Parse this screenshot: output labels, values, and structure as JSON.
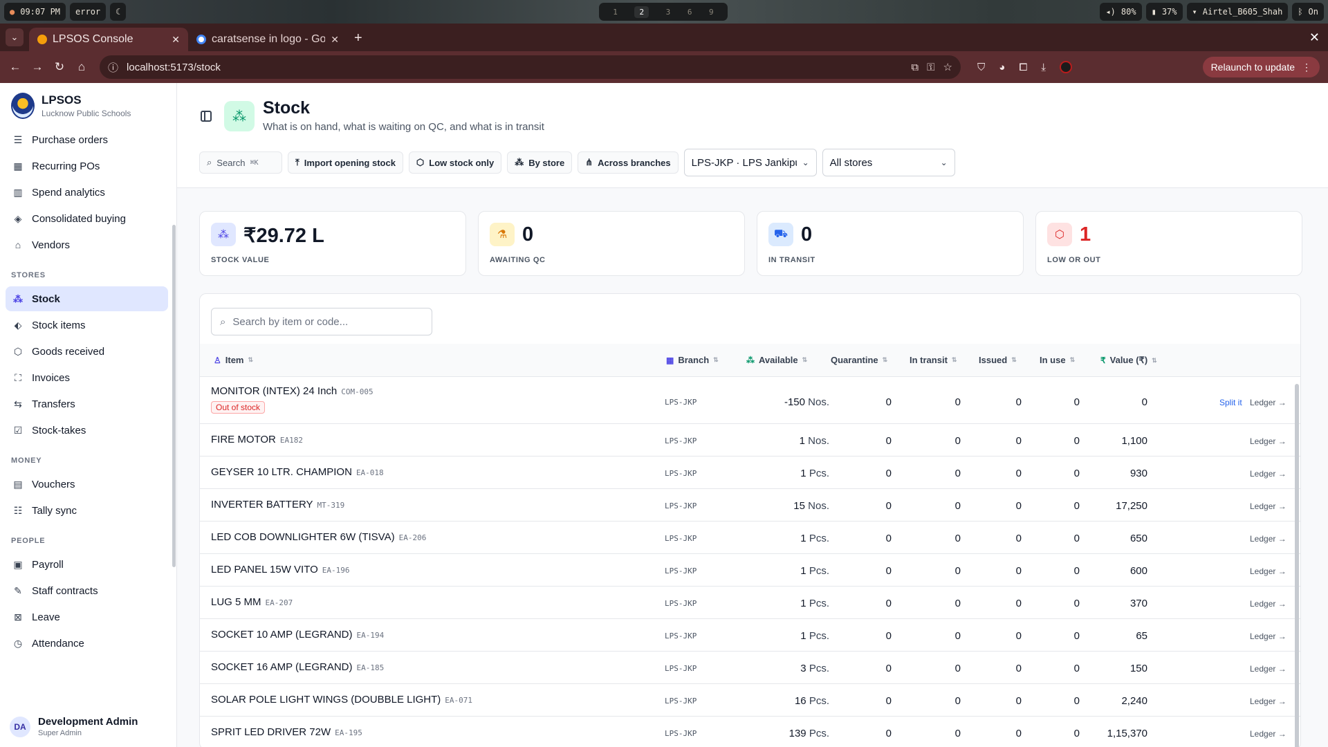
{
  "system": {
    "time": "09:07 PM",
    "status": "error",
    "workspaces": [
      "1",
      "2",
      "3",
      "6",
      "9"
    ],
    "active_workspace": "2",
    "volume": "80%",
    "battery": "37%",
    "wifi": "Airtel_B605_Shah",
    "bt": "On"
  },
  "browser": {
    "tabs": [
      {
        "title": "LPSOS Console"
      },
      {
        "title": "caratsense in logo - Go"
      }
    ],
    "url": "localhost:5173/stock",
    "relaunch_label": "Relaunch to update"
  },
  "app": {
    "name": "LPSOS",
    "subtitle": "Lucknow Public Schools"
  },
  "sidebar": {
    "top_items": [
      {
        "label": "Purchase orders"
      },
      {
        "label": "Recurring POs"
      },
      {
        "label": "Spend analytics"
      },
      {
        "label": "Consolidated buying"
      },
      {
        "label": "Vendors"
      }
    ],
    "sections": [
      {
        "title": "STORES",
        "items": [
          {
            "label": "Stock"
          },
          {
            "label": "Stock items"
          },
          {
            "label": "Goods received"
          },
          {
            "label": "Invoices"
          },
          {
            "label": "Transfers"
          },
          {
            "label": "Stock-takes"
          }
        ]
      },
      {
        "title": "MONEY",
        "items": [
          {
            "label": "Vouchers"
          },
          {
            "label": "Tally sync"
          }
        ]
      },
      {
        "title": "PEOPLE",
        "items": [
          {
            "label": "Payroll"
          },
          {
            "label": "Staff contracts"
          },
          {
            "label": "Leave"
          },
          {
            "label": "Attendance"
          }
        ]
      }
    ],
    "user": {
      "initials": "DA",
      "name": "Development Admin",
      "role": "Super Admin"
    }
  },
  "page": {
    "title": "Stock",
    "subtitle": "What is on hand, what is waiting on QC, and what is in transit",
    "toolbar": {
      "search_label": "Search",
      "search_kbd": "⌘K",
      "import_label": "Import opening stock",
      "low_stock_label": "Low stock only",
      "by_store_label": "By store",
      "across_branches_label": "Across branches",
      "branch_select": "LPS-JKP · LPS Jankipu",
      "store_select": "All stores"
    }
  },
  "stats": [
    {
      "value": "₹29.72 L",
      "label": "STOCK VALUE",
      "color": "#111827",
      "bg": "#e0e7ff",
      "icon_color": "#4f46e5"
    },
    {
      "value": "0",
      "label": "AWAITING QC",
      "color": "#111827",
      "bg": "#fef3c7",
      "icon_color": "#d97706"
    },
    {
      "value": "0",
      "label": "IN TRANSIT",
      "color": "#111827",
      "bg": "#dbeafe",
      "icon_color": "#2563eb"
    },
    {
      "value": "1",
      "label": "LOW OR OUT",
      "color": "#dc2626",
      "bg": "#fee2e2",
      "icon_color": "#dc2626"
    }
  ],
  "table": {
    "search_placeholder": "Search by item or code...",
    "headers": {
      "item": "Item",
      "branch": "Branch",
      "available": "Available",
      "quarantine": "Quarantine",
      "in_transit": "In transit",
      "issued": "Issued",
      "in_use": "In use",
      "value": "Value (₹)"
    },
    "rows": [
      {
        "name": "MONITOR (INTEX) 24 Inch",
        "code": "COM-005",
        "badge": "Out of stock",
        "branch": "LPS-JKP",
        "available": "-150",
        "unit": "Nos.",
        "quarantine": "0",
        "in_transit": "0",
        "issued": "0",
        "in_use": "0",
        "value": "0",
        "split": "Split it",
        "ledger": "Ledger →"
      },
      {
        "name": "FIRE MOTOR",
        "code": "EA182",
        "badge": "",
        "branch": "LPS-JKP",
        "available": "1",
        "unit": "Nos.",
        "quarantine": "0",
        "in_transit": "0",
        "issued": "0",
        "in_use": "0",
        "value": "1,100",
        "split": "",
        "ledger": "Ledger →"
      },
      {
        "name": "GEYSER 10 LTR. CHAMPION",
        "code": "EA-018",
        "badge": "",
        "branch": "LPS-JKP",
        "available": "1",
        "unit": "Pcs.",
        "quarantine": "0",
        "in_transit": "0",
        "issued": "0",
        "in_use": "0",
        "value": "930",
        "split": "",
        "ledger": "Ledger →"
      },
      {
        "name": "INVERTER BATTERY",
        "code": "MT-319",
        "badge": "",
        "branch": "LPS-JKP",
        "available": "15",
        "unit": "Nos.",
        "quarantine": "0",
        "in_transit": "0",
        "issued": "0",
        "in_use": "0",
        "value": "17,250",
        "split": "",
        "ledger": "Ledger →"
      },
      {
        "name": "LED COB DOWNLIGHTER 6W (TISVA)",
        "code": "EA-206",
        "badge": "",
        "branch": "LPS-JKP",
        "available": "1",
        "unit": "Pcs.",
        "quarantine": "0",
        "in_transit": "0",
        "issued": "0",
        "in_use": "0",
        "value": "650",
        "split": "",
        "ledger": "Ledger →"
      },
      {
        "name": "LED PANEL 15W VITO",
        "code": "EA-196",
        "badge": "",
        "branch": "LPS-JKP",
        "available": "1",
        "unit": "Pcs.",
        "quarantine": "0",
        "in_transit": "0",
        "issued": "0",
        "in_use": "0",
        "value": "600",
        "split": "",
        "ledger": "Ledger →"
      },
      {
        "name": "LUG 5 MM",
        "code": "EA-207",
        "badge": "",
        "branch": "LPS-JKP",
        "available": "1",
        "unit": "Pcs.",
        "quarantine": "0",
        "in_transit": "0",
        "issued": "0",
        "in_use": "0",
        "value": "370",
        "split": "",
        "ledger": "Ledger →"
      },
      {
        "name": "SOCKET 10 AMP (LEGRAND)",
        "code": "EA-194",
        "badge": "",
        "branch": "LPS-JKP",
        "available": "1",
        "unit": "Pcs.",
        "quarantine": "0",
        "in_transit": "0",
        "issued": "0",
        "in_use": "0",
        "value": "65",
        "split": "",
        "ledger": "Ledger →"
      },
      {
        "name": "SOCKET 16 AMP (LEGRAND)",
        "code": "EA-185",
        "badge": "",
        "branch": "LPS-JKP",
        "available": "3",
        "unit": "Pcs.",
        "quarantine": "0",
        "in_transit": "0",
        "issued": "0",
        "in_use": "0",
        "value": "150",
        "split": "",
        "ledger": "Ledger →"
      },
      {
        "name": "SOLAR POLE LIGHT WINGS (DOUBBLE LIGHT)",
        "code": "EA-071",
        "badge": "",
        "branch": "LPS-JKP",
        "available": "16",
        "unit": "Pcs.",
        "quarantine": "0",
        "in_transit": "0",
        "issued": "0",
        "in_use": "0",
        "value": "2,240",
        "split": "",
        "ledger": "Ledger →"
      },
      {
        "name": "SPRIT LED DRIVER 72W",
        "code": "EA-195",
        "badge": "",
        "branch": "LPS-JKP",
        "available": "139",
        "unit": "Pcs.",
        "quarantine": "0",
        "in_transit": "0",
        "issued": "0",
        "in_use": "0",
        "value": "1,15,370",
        "split": "",
        "ledger": "Ledger →"
      }
    ]
  }
}
